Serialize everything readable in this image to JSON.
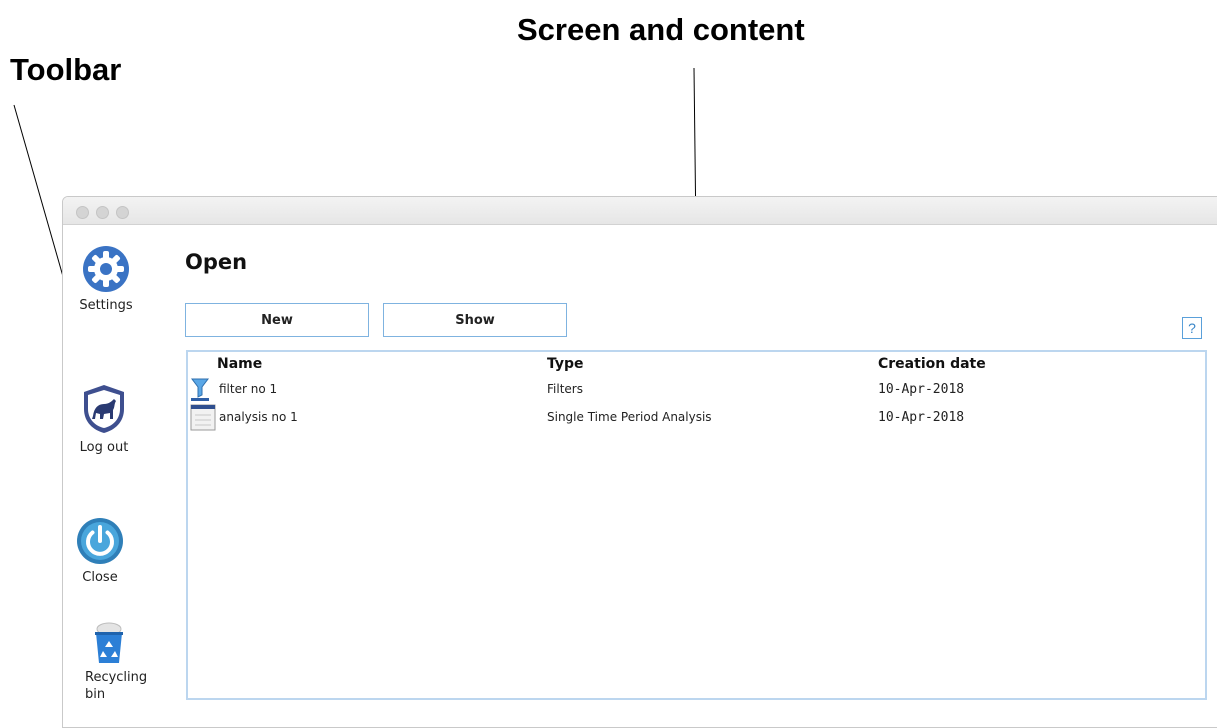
{
  "annotations": {
    "screen_label": "Screen and content",
    "toolbar_label": "Toolbar"
  },
  "toolbar": {
    "items": [
      {
        "label": "Settings",
        "icon": "gear-icon"
      },
      {
        "label": "Log out",
        "icon": "shield-panther-icon"
      },
      {
        "label": "Close",
        "icon": "power-icon"
      },
      {
        "label": "Recycling bin",
        "icon": "recycle-bin-icon"
      }
    ]
  },
  "main": {
    "title": "Open",
    "buttons": {
      "new_label": "New",
      "show_label": "Show"
    },
    "help_label": "?",
    "table": {
      "columns": [
        "Name",
        "Type",
        "Creation date"
      ],
      "rows": [
        {
          "name": "filter no 1",
          "type": "Filters",
          "date": "10-Apr-2018",
          "icon": "filter-funnel-icon"
        },
        {
          "name": "analysis no 1",
          "type": "Single Time Period Analysis",
          "date": "10-Apr-2018",
          "icon": "document-icon"
        }
      ]
    }
  },
  "colors": {
    "accent": "#3a86c8",
    "border": "#bcd6ef",
    "settings_icon": "#3a73c4"
  }
}
